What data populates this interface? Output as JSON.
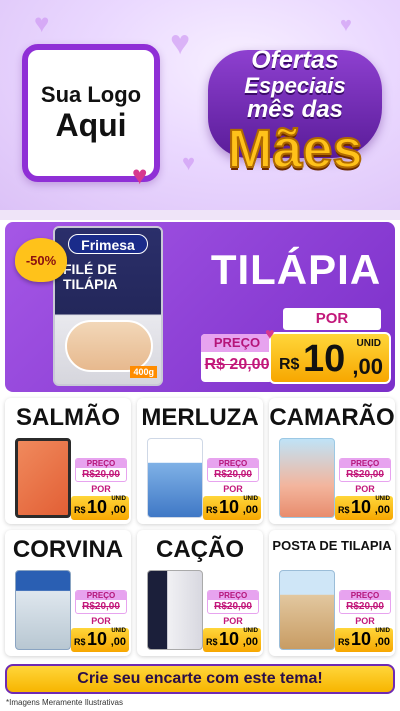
{
  "header": {
    "logo_line1": "Sua Logo",
    "logo_line2": "Aqui",
    "title_line1": "Ofertas",
    "title_line2": "Especiais",
    "title_line3": "mês das",
    "title_line4": "Mães"
  },
  "hero": {
    "discount": "-50%",
    "pack_brand": "Frimesa",
    "pack_name": "FILÉ DE TILÁPIA",
    "pack_weight": "400g",
    "product": "TILÁPIA",
    "preco_label": "PREÇO",
    "old_price": "R$ 20,00",
    "por_label": "POR",
    "currency": "R$",
    "price_int": "10",
    "price_cents": ",00",
    "unit": "UNID"
  },
  "products": [
    {
      "name": "SALMÃO",
      "preco_label": "PREÇO",
      "old_price": "R$20,00",
      "por_label": "POR",
      "currency": "R$",
      "price_int": "10",
      "price_cents": ",00",
      "unit": "UNID"
    },
    {
      "name": "MERLUZA",
      "preco_label": "PREÇO",
      "old_price": "R$20,00",
      "por_label": "POR",
      "currency": "R$",
      "price_int": "10",
      "price_cents": ",00",
      "unit": "UNID"
    },
    {
      "name": "CAMARÃO",
      "preco_label": "PREÇO",
      "old_price": "R$20,00",
      "por_label": "POR",
      "currency": "R$",
      "price_int": "10",
      "price_cents": ",00",
      "unit": "UNID"
    },
    {
      "name": "CORVINA",
      "preco_label": "PREÇO",
      "old_price": "R$20,00",
      "por_label": "POR",
      "currency": "R$",
      "price_int": "10",
      "price_cents": ",00",
      "unit": "UNID"
    },
    {
      "name": "CAÇÃO",
      "preco_label": "PREÇO",
      "old_price": "R$20,00",
      "por_label": "POR",
      "currency": "R$",
      "price_int": "10",
      "price_cents": ",00",
      "unit": "UNID"
    },
    {
      "name": "POSTA DE TILAPIA",
      "preco_label": "PREÇO",
      "old_price": "R$20,00",
      "por_label": "POR",
      "currency": "R$",
      "price_int": "10",
      "price_cents": ",00",
      "unit": "UNID"
    }
  ],
  "cta": {
    "label": "Crie seu encarte com este tema!"
  },
  "footer": {
    "disclaimer": "*Imagens Meramente Ilustrativas"
  },
  "colors": {
    "accent": "#8f2fd6",
    "price_yellow": "#ffc21a",
    "pink": "#c2187a"
  }
}
